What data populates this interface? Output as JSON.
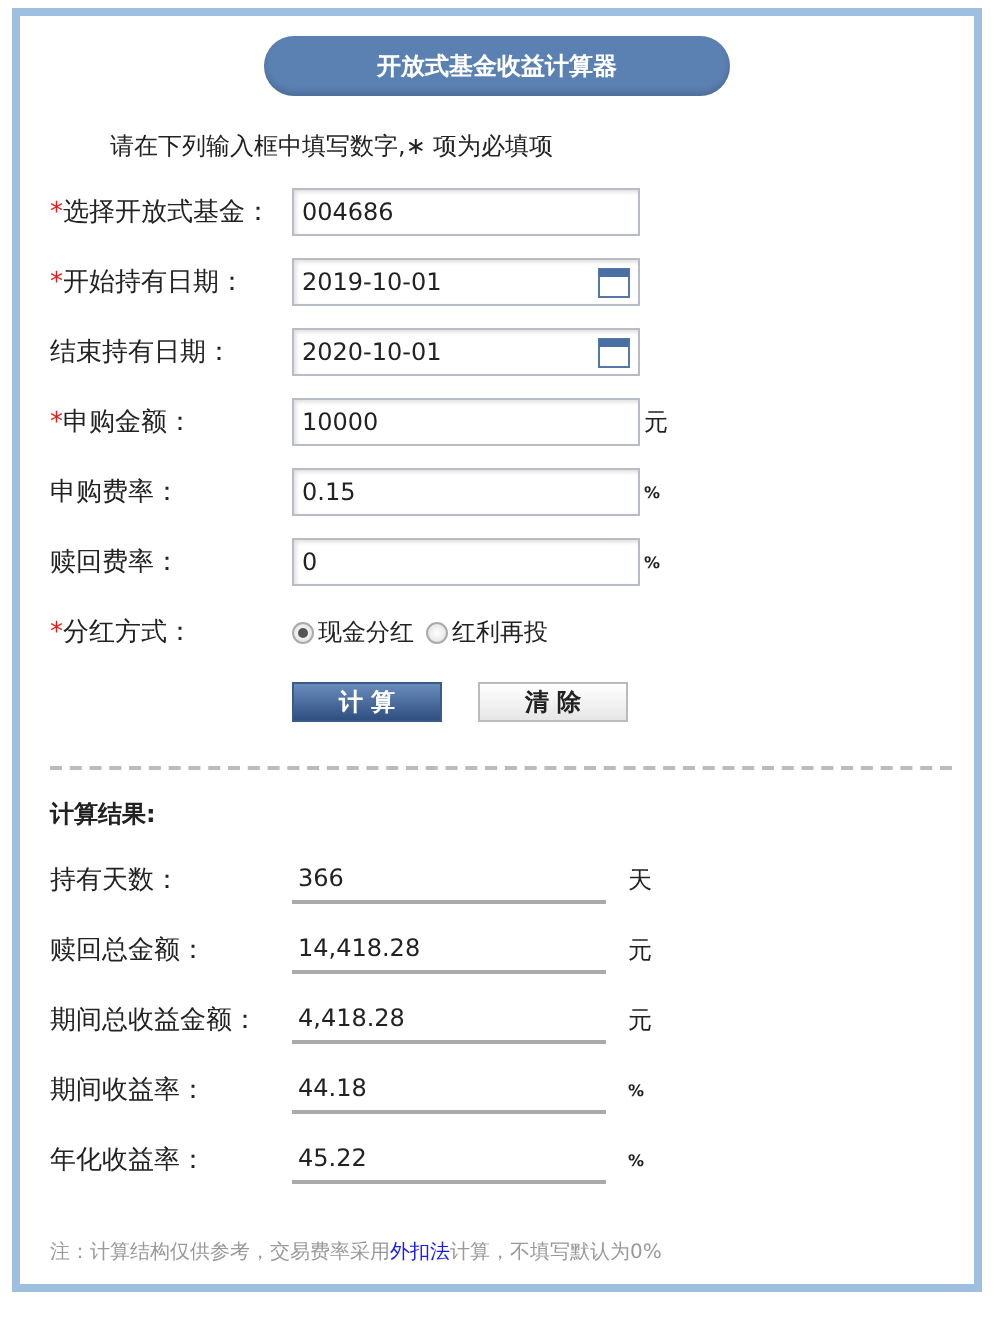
{
  "title": "开放式基金收益计算器",
  "required_mark": "*",
  "instruction": "请在下列输入框中填写数字,∗ 项为必填项",
  "fields": [
    {
      "kind": "text",
      "required": true,
      "label": "选择开放式基金：",
      "value": "004686"
    },
    {
      "kind": "date",
      "required": true,
      "label": "开始持有日期：",
      "value": "2019-10-01"
    },
    {
      "kind": "date",
      "required": false,
      "label": "结束持有日期：",
      "value": "2020-10-01"
    },
    {
      "kind": "text",
      "required": true,
      "label": "申购金额：",
      "value": "10000",
      "unit": "元"
    },
    {
      "kind": "text",
      "required": false,
      "label": "申购费率：",
      "value": "0.15",
      "unit": "%"
    },
    {
      "kind": "text",
      "required": false,
      "label": "赎回费率：",
      "value": "0",
      "unit": "%"
    }
  ],
  "dividend": {
    "required": true,
    "label": "分红方式：",
    "options": [
      {
        "label": "现金分红",
        "selected": true
      },
      {
        "label": "红利再投",
        "selected": false
      }
    ]
  },
  "buttons": [
    {
      "kind": "primary",
      "label": "计 算"
    },
    {
      "kind": "secondary",
      "label": "清 除"
    }
  ],
  "results_title": "计算结果:",
  "results": [
    {
      "label": "持有天数：",
      "value": "366",
      "unit": "天"
    },
    {
      "label": "赎回总金额：",
      "value": "14,418.28",
      "unit": "元"
    },
    {
      "label": "期间总收益金额：",
      "value": "4,418.28",
      "unit": "元"
    },
    {
      "label": "期间收益率：",
      "value": "44.18",
      "unit": "%"
    },
    {
      "label": "年化收益率：",
      "value": "45.22",
      "unit": "%"
    }
  ],
  "note": {
    "before": "注：计算结构仅供参考，交易费率采用",
    "link": "外扣法",
    "after": "计算，不填写默认为0%"
  }
}
